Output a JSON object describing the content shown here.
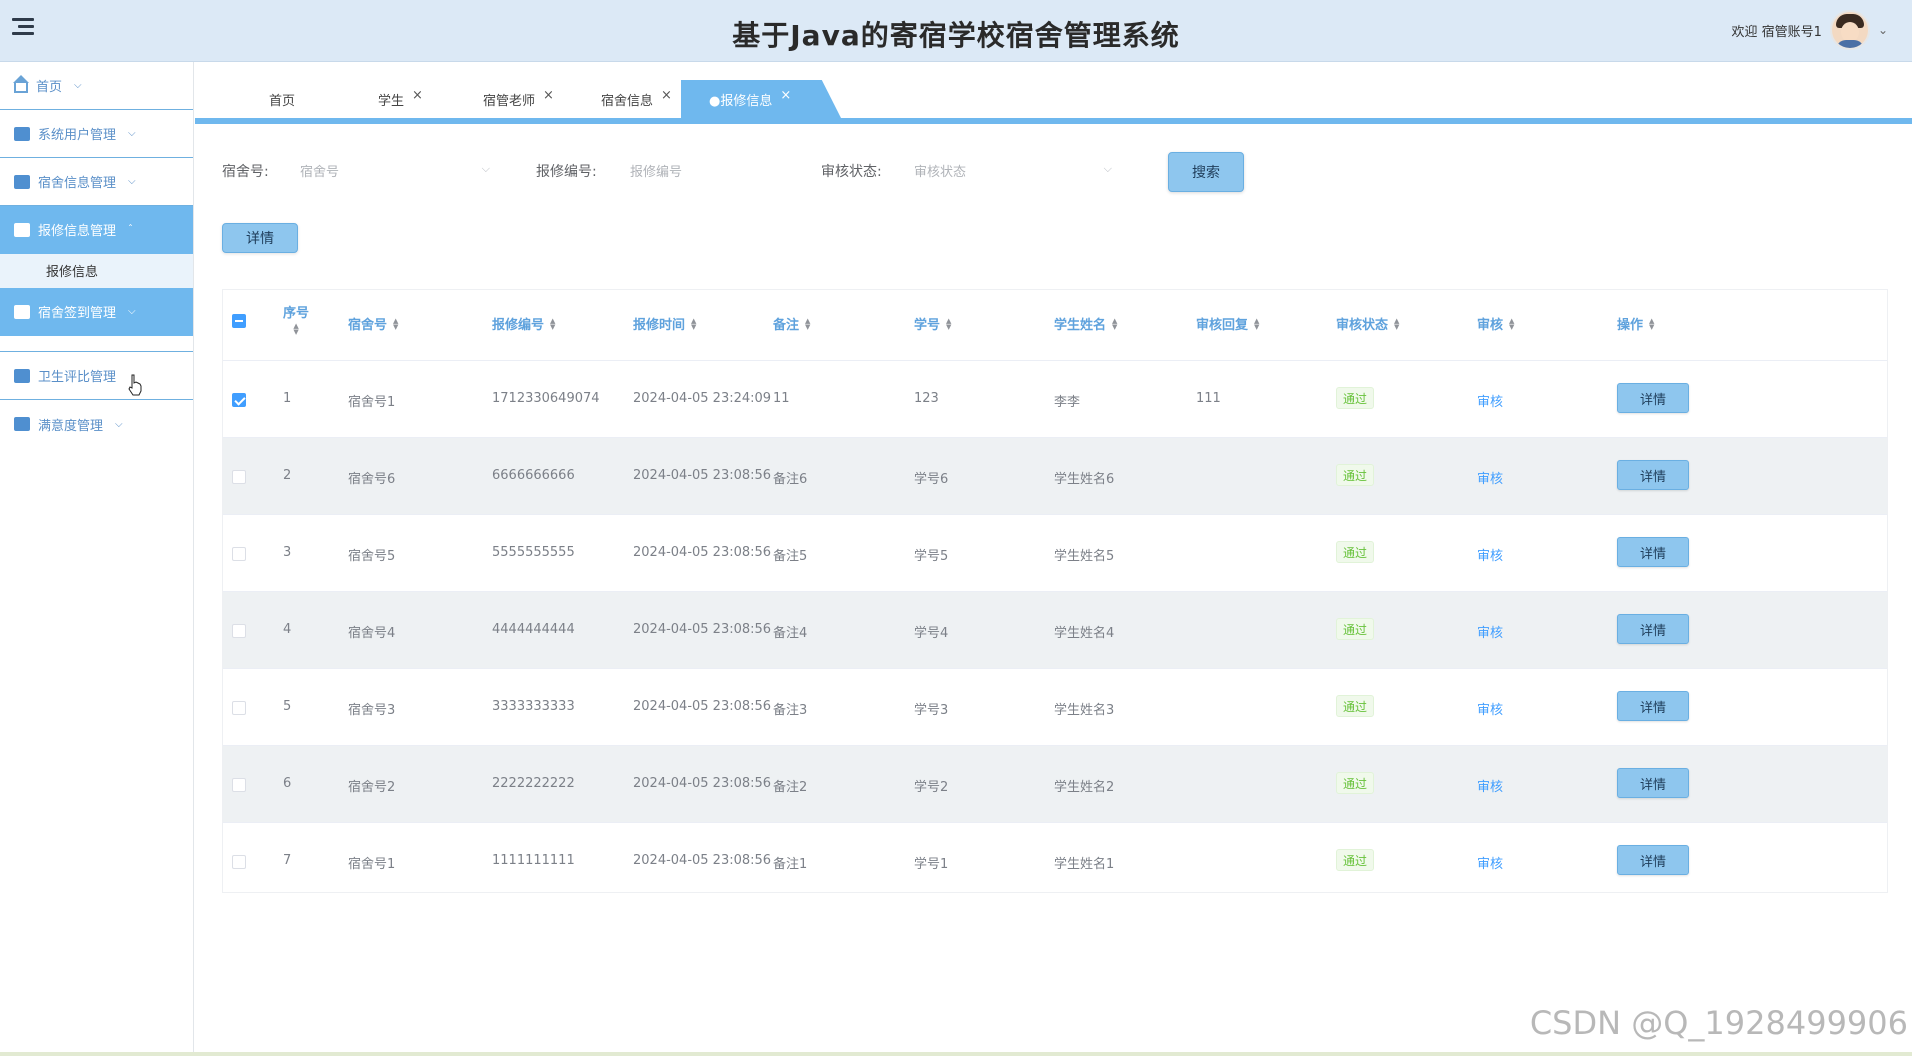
{
  "header": {
    "title": "基于Java的寄宿学校宿舍管理系统",
    "welcome": "欢迎 宿管账号1",
    "caret": "⌄"
  },
  "sidebar": {
    "items": [
      {
        "label": "首页",
        "icon": "home-icon"
      },
      {
        "label": "系统用户管理",
        "icon": "users-block-icon"
      },
      {
        "label": "宿舍信息管理",
        "icon": "dorm-block-icon"
      },
      {
        "label": "报修信息管理",
        "icon": "repair-grid-icon",
        "active": true
      },
      {
        "label": "报修信息",
        "sub": true
      },
      {
        "label": "宿舍签到管理",
        "icon": "signin-grid-icon",
        "active": true
      },
      {
        "label": "卫生评比管理",
        "icon": "hygiene-grid-icon"
      },
      {
        "label": "满意度管理",
        "icon": "satisfaction-block-icon"
      }
    ]
  },
  "tabs": [
    {
      "label": "首页"
    },
    {
      "label": "学生",
      "close": "×"
    },
    {
      "label": "宿管老师",
      "close": "×"
    },
    {
      "label": "宿舍信息",
      "close": "×"
    },
    {
      "label": "●报修信息",
      "close": "×",
      "active": true
    }
  ],
  "search": {
    "dorm_label": "宿舍号:",
    "dorm_placeholder": "宿舍号",
    "repair_label": "报修编号:",
    "repair_placeholder": "报修编号",
    "status_label": "审核状态:",
    "status_placeholder": "审核状态",
    "search_button": "搜索",
    "detail_button": "详情"
  },
  "table": {
    "headers": [
      "序号",
      "宿舍号",
      "报修编号",
      "报修时间",
      "备注",
      "学号",
      "学生姓名",
      "审核回复",
      "审核状态",
      "审核",
      "操作"
    ],
    "rows": [
      {
        "checked": true,
        "index": "1",
        "dorm": "宿舍号1",
        "repair_no": "1712330649074",
        "time": "2024-04-05 23:24:09",
        "remark": "11",
        "student_no": "123",
        "student_name": "李李",
        "reply": "111",
        "status": "通过",
        "audit": "审核",
        "action": "详情"
      },
      {
        "checked": false,
        "index": "2",
        "dorm": "宿舍号6",
        "repair_no": "6666666666",
        "time": "2024-04-05 23:08:56",
        "remark": "备注6",
        "student_no": "学号6",
        "student_name": "学生姓名6",
        "reply": "",
        "status": "通过",
        "audit": "审核",
        "action": "详情"
      },
      {
        "checked": false,
        "index": "3",
        "dorm": "宿舍号5",
        "repair_no": "5555555555",
        "time": "2024-04-05 23:08:56",
        "remark": "备注5",
        "student_no": "学号5",
        "student_name": "学生姓名5",
        "reply": "",
        "status": "通过",
        "audit": "审核",
        "action": "详情"
      },
      {
        "checked": false,
        "index": "4",
        "dorm": "宿舍号4",
        "repair_no": "4444444444",
        "time": "2024-04-05 23:08:56",
        "remark": "备注4",
        "student_no": "学号4",
        "student_name": "学生姓名4",
        "reply": "",
        "status": "通过",
        "audit": "审核",
        "action": "详情"
      },
      {
        "checked": false,
        "index": "5",
        "dorm": "宿舍号3",
        "repair_no": "3333333333",
        "time": "2024-04-05 23:08:56",
        "remark": "备注3",
        "student_no": "学号3",
        "student_name": "学生姓名3",
        "reply": "",
        "status": "通过",
        "audit": "审核",
        "action": "详情"
      },
      {
        "checked": false,
        "index": "6",
        "dorm": "宿舍号2",
        "repair_no": "2222222222",
        "time": "2024-04-05 23:08:56",
        "remark": "备注2",
        "student_no": "学号2",
        "student_name": "学生姓名2",
        "reply": "",
        "status": "通过",
        "audit": "审核",
        "action": "详情"
      },
      {
        "checked": false,
        "index": "7",
        "dorm": "宿舍号1",
        "repair_no": "1111111111",
        "time": "2024-04-05 23:08:56",
        "remark": "备注1",
        "student_no": "学号1",
        "student_name": "学生姓名1",
        "reply": "",
        "status": "通过",
        "audit": "审核",
        "action": "详情"
      }
    ]
  },
  "watermark": "CSDN @Q_1928499906",
  "colors": {
    "accent": "#6fb8ee",
    "header_bg": "#dce9f6",
    "status_green": "#67c23a",
    "link_blue": "#409eff"
  }
}
